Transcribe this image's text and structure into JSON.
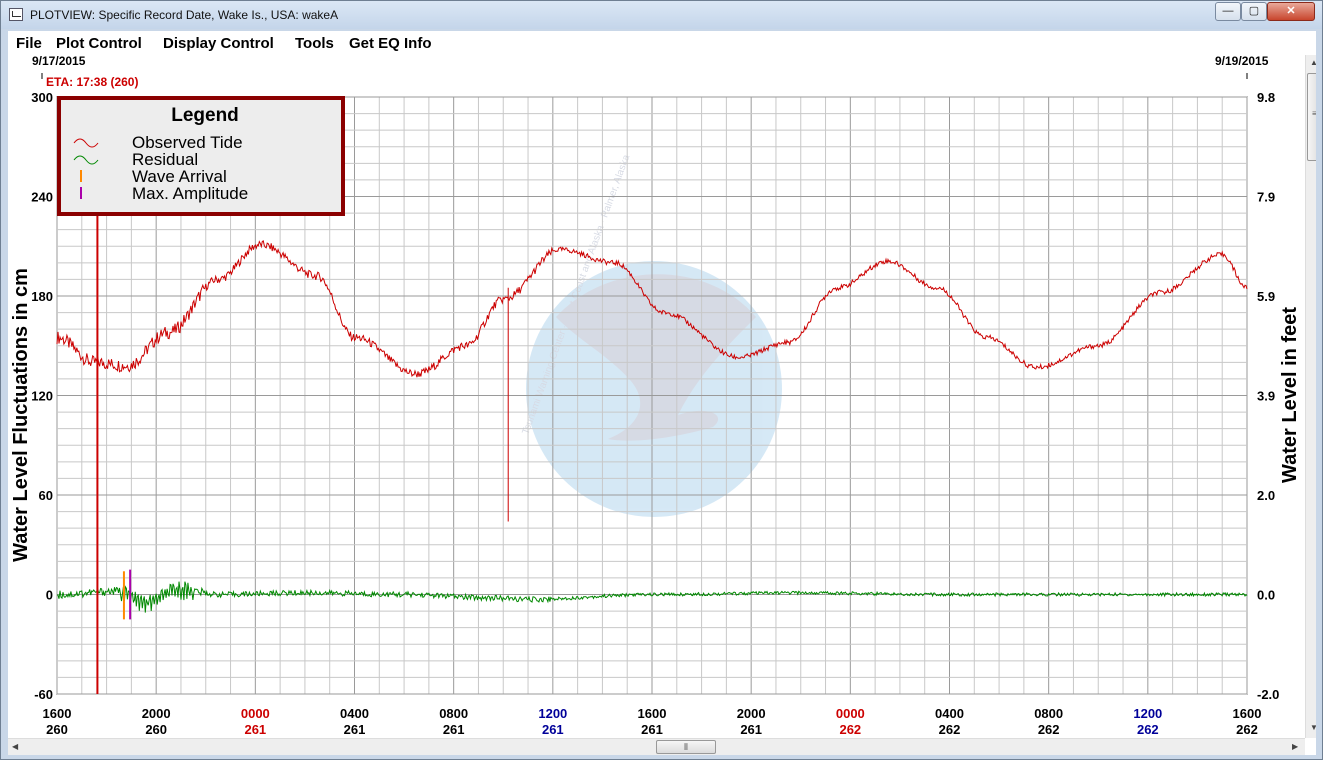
{
  "window": {
    "title": "PLOTVIEW: Specific Record Date, Wake Is., USA: wakeA",
    "minimize_glyph": "—",
    "maximize_glyph": "▢",
    "close_glyph": "✕"
  },
  "menu": [
    "File",
    "Plot Control",
    "Display Control",
    "Tools",
    "Get EQ Info"
  ],
  "scrollbar": {
    "grip_glyph": "⦀"
  },
  "plot": {
    "start_date": "9/17/2015",
    "end_date": "9/19/2015",
    "eta_label": "ETA: 17:38 (260)",
    "legend_title": "Legend",
    "legend_items": [
      {
        "label": "Observed Tide",
        "color": "#cc0000",
        "kind": "wave"
      },
      {
        "label": "Residual",
        "color": "#008800",
        "kind": "wave"
      },
      {
        "label": "Wave Arrival",
        "color": "#ff8800",
        "kind": "tick"
      },
      {
        "label": "Max. Amplitude",
        "color": "#aa00aa",
        "kind": "tick"
      }
    ],
    "watermark_text": "Tsunami Warning Center  ·  West Coast and Alaska  ·  Palmer, Alaska"
  },
  "colors": {
    "tide": "#cc0000",
    "residual": "#008800",
    "arrival": "#ff8800",
    "max_amp": "#aa00aa",
    "hour_0000": "#cc0000",
    "hour_1200": "#000099",
    "legend_border": "#8b0000"
  },
  "chart_data": {
    "type": "line",
    "xlabel": "",
    "ylabel": "Water Level Fluctuations in cm",
    "ylabel_right": "Water Level in feet",
    "ylim": [
      -60,
      300
    ],
    "ylim_right": [
      -2.0,
      9.8
    ],
    "y_ticks": [
      "-60",
      "0",
      "60",
      "120",
      "180",
      "240",
      "300"
    ],
    "y_ticks_right": [
      "-2.0",
      "0.0",
      "2.0",
      "3.9",
      "5.9",
      "7.9",
      "9.8"
    ],
    "xlim_hours": [
      0,
      48
    ],
    "x_ticks": [
      {
        "time": "1600",
        "day": "260",
        "accent": ""
      },
      {
        "time": "2000",
        "day": "260",
        "accent": ""
      },
      {
        "time": "0000",
        "day": "261",
        "accent": "midnight"
      },
      {
        "time": "0400",
        "day": "261",
        "accent": ""
      },
      {
        "time": "0800",
        "day": "261",
        "accent": ""
      },
      {
        "time": "1200",
        "day": "261",
        "accent": "noon"
      },
      {
        "time": "1600",
        "day": "261",
        "accent": ""
      },
      {
        "time": "2000",
        "day": "261",
        "accent": ""
      },
      {
        "time": "0000",
        "day": "262",
        "accent": "midnight"
      },
      {
        "time": "0400",
        "day": "262",
        "accent": ""
      },
      {
        "time": "0800",
        "day": "262",
        "accent": ""
      },
      {
        "time": "1200",
        "day": "262",
        "accent": "noon"
      },
      {
        "time": "1600",
        "day": "262",
        "accent": ""
      }
    ],
    "grid": true,
    "legend_position": "top-left",
    "eta_hour": 1.63,
    "wave_arrival_hour": 2.7,
    "max_amplitude_hour": 2.95,
    "spike": {
      "hour": 18.2,
      "from": 185,
      "to": 44
    },
    "series": [
      {
        "name": "Observed Tide",
        "hours": [
          0,
          1.5,
          2.8,
          4.5,
          6.5,
          8.2,
          10.5,
          12.0,
          14.5,
          16.5,
          18.0,
          20.3,
          22.5,
          24.5,
          27.5,
          29.5,
          31.5,
          33.5,
          35.5,
          37.5,
          39.5,
          42.0,
          44.5,
          47,
          48
        ],
        "values": [
          155,
          140,
          138,
          158,
          190,
          211,
          192,
          155,
          133,
          150,
          178,
          208,
          200,
          170,
          143,
          152,
          185,
          201,
          185,
          155,
          137,
          150,
          182,
          205,
          185
        ]
      },
      {
        "name": "Residual",
        "hours": [
          0,
          2.5,
          3.5,
          5.0,
          6.5,
          10.0,
          14.0,
          17.5,
          19.0,
          24.0,
          30.0,
          36.0,
          42.0,
          48
        ],
        "values": [
          0,
          2,
          -5,
          3,
          0,
          1,
          0,
          -2,
          -3,
          0,
          1,
          0,
          0,
          0
        ]
      }
    ]
  }
}
